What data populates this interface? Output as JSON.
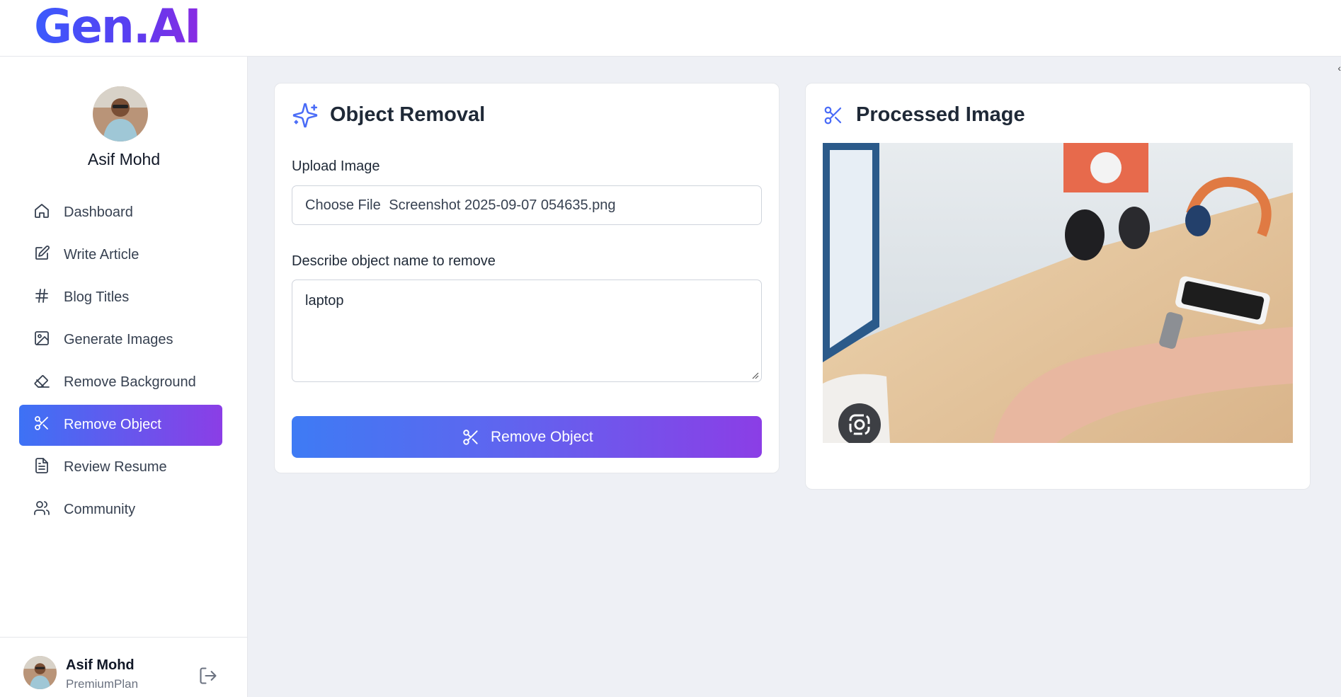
{
  "app": {
    "logo_text": "Gen.AI",
    "accent_start": "#3d72f5",
    "accent_end": "#8b3ee6"
  },
  "sidebar": {
    "profile_name": "Asif Mohd",
    "items": [
      {
        "label": "Dashboard",
        "icon": "home-icon",
        "active": false
      },
      {
        "label": "Write Article",
        "icon": "edit-icon",
        "active": false
      },
      {
        "label": "Blog Titles",
        "icon": "hash-icon",
        "active": false
      },
      {
        "label": "Generate Images",
        "icon": "image-icon",
        "active": false
      },
      {
        "label": "Remove Background",
        "icon": "eraser-icon",
        "active": false
      },
      {
        "label": "Remove Object",
        "icon": "scissors-icon",
        "active": true
      },
      {
        "label": "Review Resume",
        "icon": "file-text-icon",
        "active": false
      },
      {
        "label": "Community",
        "icon": "users-icon",
        "active": false
      }
    ],
    "footer": {
      "name": "Asif Mohd",
      "plan": "PremiumPlan",
      "logout_icon": "logout-icon"
    }
  },
  "form": {
    "title": "Object Removal",
    "title_icon": "sparkles-icon",
    "upload_label": "Upload Image",
    "file_button": "Choose File",
    "file_name": "Screenshot 2025-09-07 054635.png",
    "describe_label": "Describe object name to remove",
    "describe_value": "laptop",
    "submit_label": "Remove Object",
    "submit_icon": "scissors-icon"
  },
  "result": {
    "title": "Processed Image",
    "title_icon": "scissors-icon",
    "lens_icon": "camera-lens-icon"
  }
}
